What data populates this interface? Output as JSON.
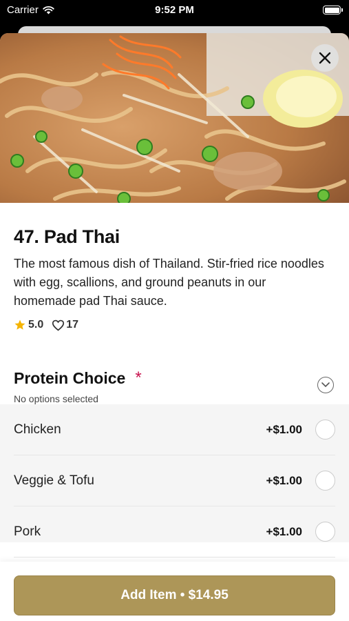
{
  "status_bar": {
    "carrier": "Carrier",
    "time": "9:52 PM"
  },
  "item": {
    "title": "47. Pad Thai",
    "description": "The most famous dish of Thailand. Stir-fried rice noodles with egg, scallions, and ground peanuts in our homemade pad Thai sauce.",
    "rating": "5.0",
    "likes": "17"
  },
  "protein": {
    "title": "Protein Choice",
    "required_marker": "*",
    "subtitle": "No options selected",
    "options": [
      {
        "name": "Chicken",
        "price": "+$1.00"
      },
      {
        "name": "Veggie & Tofu",
        "price": "+$1.00"
      },
      {
        "name": "Pork",
        "price": "+$1.00"
      }
    ]
  },
  "footer": {
    "button_label": "Add Item • $14.95"
  },
  "colors": {
    "accent": "#ad9658",
    "required": "#c8134f",
    "star": "#f5b400"
  },
  "icons": [
    "wifi-icon",
    "battery-icon",
    "close-icon",
    "star-icon",
    "heart-icon",
    "chevron-down-icon"
  ]
}
